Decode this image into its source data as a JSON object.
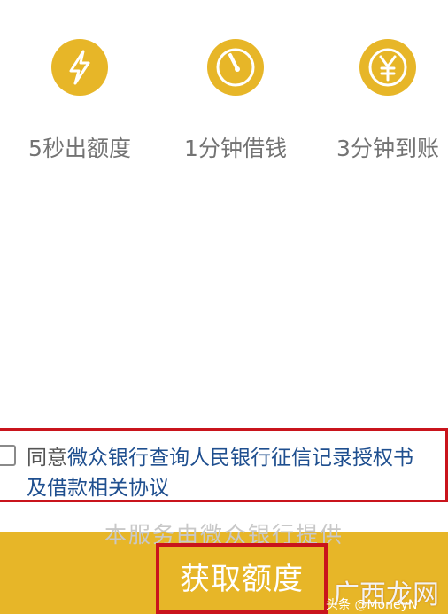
{
  "features": [
    {
      "label": "5秒出额度",
      "icon": "lightning-icon"
    },
    {
      "label": "1分钟借钱",
      "icon": "timer-icon"
    },
    {
      "label": "3分钟到账",
      "icon": "yen-icon"
    }
  ],
  "agreement": {
    "prefix": "同意",
    "text_line1": "微众银行查询人民银行征信记录授权书",
    "text_line2": "及借款相关协议",
    "checked": false
  },
  "footer": {
    "provider_text": "本服务由微众银行提供",
    "cta_label": "获取额度"
  },
  "watermark": {
    "text": "广西龙网",
    "sub": "头条 @MoneyN"
  },
  "colors": {
    "accent": "#e7b628",
    "highlight_border": "#c9141c",
    "link": "#1f4f8f"
  }
}
